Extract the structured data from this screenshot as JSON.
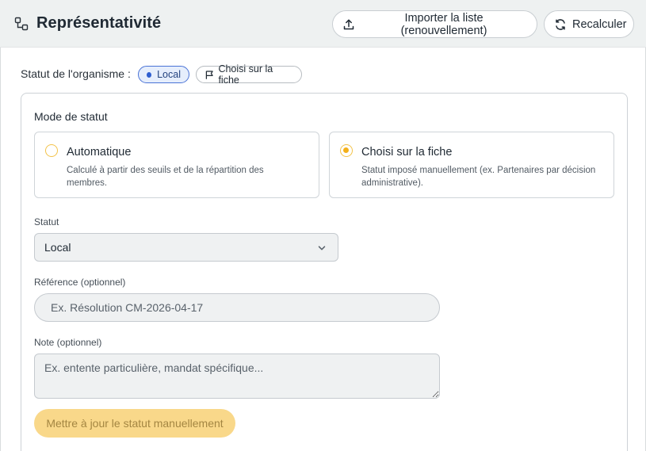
{
  "header": {
    "title": "Représentativité",
    "icon": "nodes-icon",
    "import_label": "Importer la liste (renouvellement)",
    "recalc_label": "Recalculer"
  },
  "status_line": {
    "label": "Statut de l'organisme :",
    "badge_local": "Local",
    "badge_choice": "Choisi sur la fiche"
  },
  "mode": {
    "title": "Mode de statut",
    "options": [
      {
        "title": "Automatique",
        "description": "Calculé à partir des seuils et de la répartition des membres.",
        "selected": false
      },
      {
        "title": "Choisi sur la fiche",
        "description": "Statut imposé manuellement (ex. Partenaires par décision administrative).",
        "selected": true
      }
    ]
  },
  "form": {
    "statut_label": "Statut",
    "statut_value": "Local",
    "reference_label": "Référence (optionnel)",
    "reference_placeholder": "Ex. Résolution CM-2026-04-17",
    "note_label": "Note (optionnel)",
    "note_placeholder": "Ex. entente particulière, mandat spécifique...",
    "submit_label": "Mettre à jour le statut manuellement"
  },
  "colors": {
    "accent": "#f3b01a",
    "submit_disabled": "#f9d88a",
    "badge_blue": "#2f5fd0",
    "header_bg": "#eef1f1"
  }
}
